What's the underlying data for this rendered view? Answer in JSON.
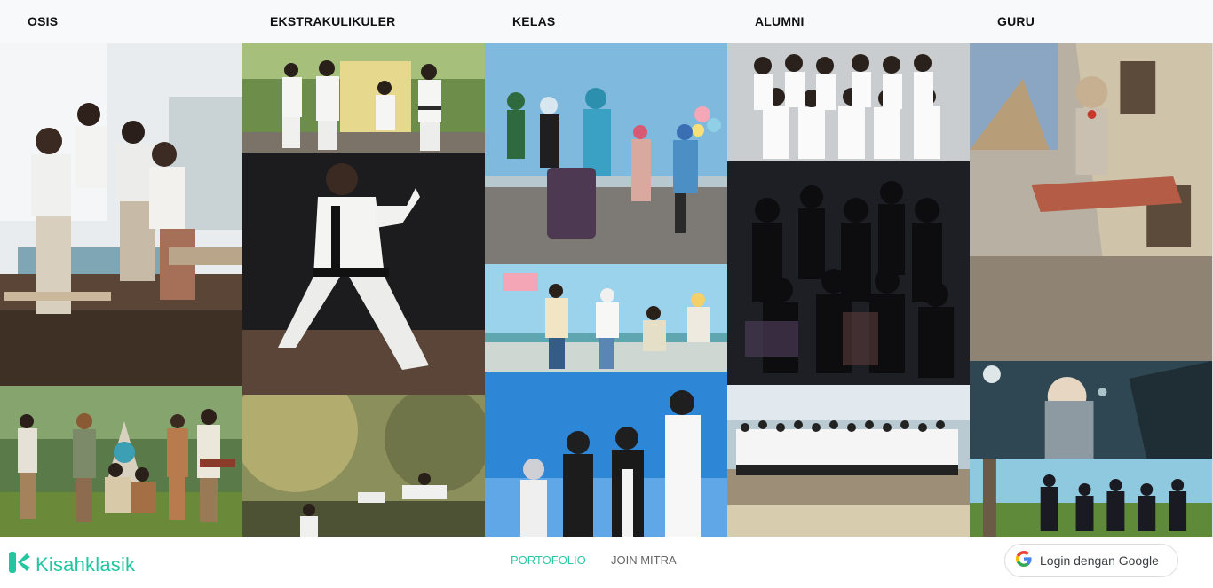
{
  "columns": [
    {
      "title": "OSIS"
    },
    {
      "title": "EKSTRAKULIKULER"
    },
    {
      "title": "KELAS"
    },
    {
      "title": "ALUMNI"
    },
    {
      "title": "GURU"
    }
  ],
  "footer": {
    "brand": "Kisahklasik",
    "nav": [
      "PORTOFOLIO",
      "JOIN MITRA"
    ],
    "login_label": "Login dengan Google"
  },
  "colors": {
    "brand": "#23c6a0",
    "nav_active": "#2ec8a6",
    "nav_inactive": "#666666"
  }
}
